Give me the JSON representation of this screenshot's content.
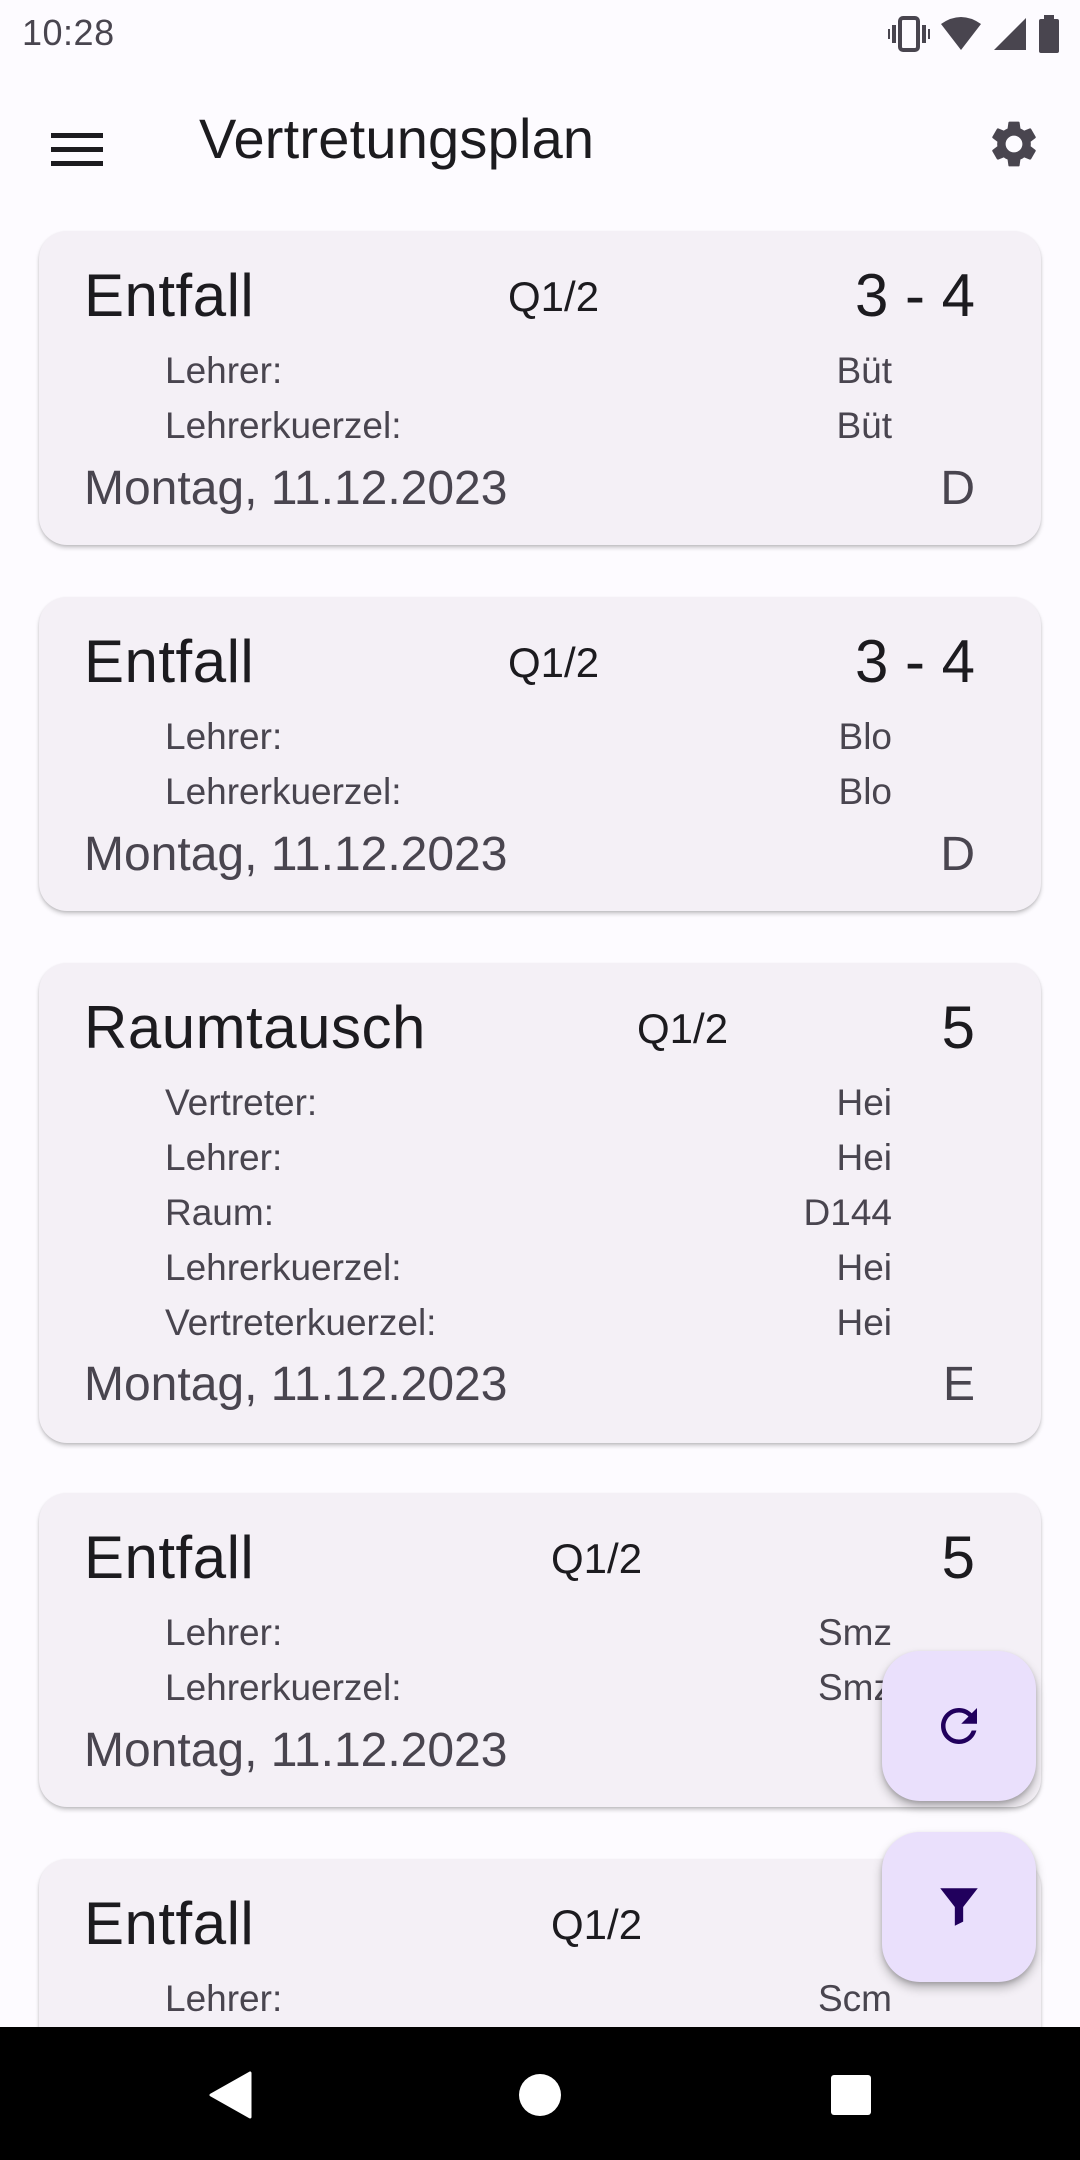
{
  "status_bar": {
    "time": "10:28"
  },
  "app_bar": {
    "title": "Vertretungsplan"
  },
  "cards": [
    {
      "type": "Entfall",
      "class": "Q1/2",
      "period": "3 - 4",
      "rows": [
        {
          "label": "Lehrer:",
          "value": "Büt"
        },
        {
          "label": "Lehrerkuerzel:",
          "value": "Büt"
        }
      ],
      "date": "Montag, 11.12.2023",
      "subject": "D"
    },
    {
      "type": "Entfall",
      "class": "Q1/2",
      "period": "3 - 4",
      "rows": [
        {
          "label": "Lehrer:",
          "value": "Blo"
        },
        {
          "label": "Lehrerkuerzel:",
          "value": "Blo"
        }
      ],
      "date": "Montag, 11.12.2023",
      "subject": "D"
    },
    {
      "type": "Raumtausch",
      "class": "Q1/2",
      "period": "5",
      "rows": [
        {
          "label": "Vertreter:",
          "value": "Hei"
        },
        {
          "label": "Lehrer:",
          "value": "Hei"
        },
        {
          "label": "Raum:",
          "value": "D144"
        },
        {
          "label": "Lehrerkuerzel:",
          "value": "Hei"
        },
        {
          "label": "Vertreterkuerzel:",
          "value": "Hei"
        }
      ],
      "date": "Montag, 11.12.2023",
      "subject": "E"
    },
    {
      "type": "Entfall",
      "class": "Q1/2",
      "period": "5",
      "rows": [
        {
          "label": "Lehrer:",
          "value": "Smz"
        },
        {
          "label": "Lehrerkuerzel:",
          "value": "Smz"
        }
      ],
      "date": "Montag, 11.12.2023",
      "subject": ""
    },
    {
      "type": "Entfall",
      "class": "Q1/2",
      "period": "",
      "rows": [
        {
          "label": "Lehrer:",
          "value": "Scm"
        }
      ],
      "date": "",
      "subject": ""
    }
  ],
  "fabs": {
    "refresh_icon": "refresh-icon",
    "filter_icon": "filter-icon"
  },
  "colors": {
    "card_background": "#f4f0f6",
    "fab_background": "#eae0fc",
    "fab_icon": "#21005d"
  }
}
